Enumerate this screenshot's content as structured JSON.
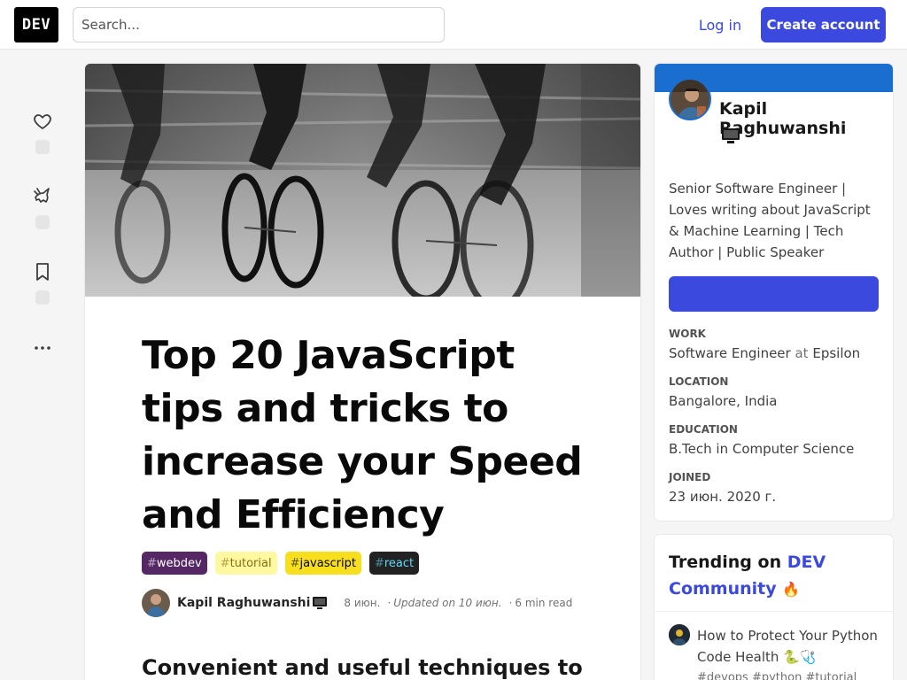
{
  "header": {
    "logo_text": "DEV",
    "search_placeholder": "Search...",
    "login_label": "Log in",
    "create_account_label": "Create account"
  },
  "reactions": {
    "icons": [
      "heart-icon",
      "unicorn-icon",
      "bookmark-icon",
      "more-icon"
    ]
  },
  "article": {
    "title": "Top 20 JavaScript tips and tricks to increase your Speed and Efficiency",
    "tags": [
      {
        "hash": "#",
        "name": "webdev",
        "bg": "#562765",
        "fg": "#ffffff"
      },
      {
        "hash": "#",
        "name": "tutorial",
        "bg": "#fef9a0",
        "fg": "#8a6d0a"
      },
      {
        "hash": "#",
        "name": "javascript",
        "bg": "#f7df1e",
        "fg": "#000000"
      },
      {
        "hash": "#",
        "name": "react",
        "bg": "#222222",
        "fg": "#61dafb"
      }
    ],
    "author": "Kapil Raghuwanshi",
    "posted": "8 июн.",
    "updated": "Updated on 10 июн.",
    "read_time": "6 min read",
    "subheading": "Convenient and useful techniques to"
  },
  "profile": {
    "name": "Kapil Raghuwanshi",
    "bio": "Senior Software Engineer | Loves writing about JavaScript & Machine Learning | Tech Author | Public Speaker",
    "follow_label": "",
    "work_label": "WORK",
    "work_role": "Software Engineer",
    "work_at": "at",
    "work_company": "Epsilon",
    "location_label": "LOCATION",
    "location_value": "Bangalore, India",
    "education_label": "EDUCATION",
    "education_value": "B.Tech in Computer Science",
    "joined_label": "JOINED",
    "joined_value": "23 июн. 2020 г."
  },
  "trending": {
    "prefix": "Trending on",
    "brand": "DEV Community",
    "fire": "🔥",
    "item_title": "How to Protect Your Python Code Health",
    "item_emoji": "🐍🩺",
    "item_tags": "#devops  #python  #tutorial"
  },
  "colors": {
    "accent": "#3b49df",
    "profile_brand": "#1a6ecf"
  }
}
